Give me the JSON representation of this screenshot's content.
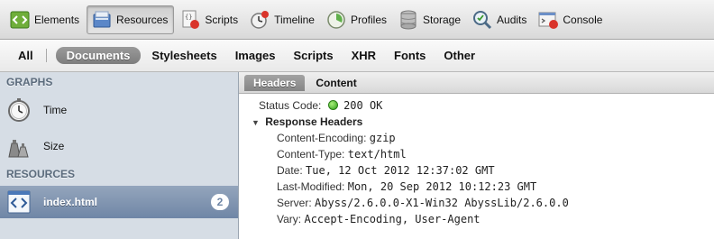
{
  "toolbar": {
    "items": [
      {
        "label": "Elements",
        "icon": "elements-icon",
        "selected": false
      },
      {
        "label": "Resources",
        "icon": "resources-icon",
        "selected": true
      },
      {
        "label": "Scripts",
        "icon": "scripts-icon",
        "selected": false
      },
      {
        "label": "Timeline",
        "icon": "timeline-icon",
        "selected": false
      },
      {
        "label": "Profiles",
        "icon": "profiles-icon",
        "selected": false
      },
      {
        "label": "Storage",
        "icon": "storage-icon",
        "selected": false
      },
      {
        "label": "Audits",
        "icon": "audits-icon",
        "selected": false
      },
      {
        "label": "Console",
        "icon": "console-icon",
        "selected": false
      }
    ]
  },
  "filters": {
    "all": "All",
    "documents": "Documents",
    "stylesheets": "Stylesheets",
    "images": "Images",
    "scripts": "Scripts",
    "xhr": "XHR",
    "fonts": "Fonts",
    "other": "Other",
    "selected": "Documents"
  },
  "sidebar": {
    "graphs_heading": "GRAPHS",
    "time_label": "Time",
    "size_label": "Size",
    "resources_heading": "RESOURCES",
    "resource": {
      "label": "index.html",
      "badge": "2"
    }
  },
  "tabs": {
    "headers": "Headers",
    "content": "Content",
    "selected": "Headers"
  },
  "headers": {
    "status_label": "Status Code:",
    "status_value": "200 OK",
    "status_color": "#3cb026",
    "response_headers_label": "Response Headers",
    "items": [
      {
        "key": "Content-Encoding:",
        "value": "gzip"
      },
      {
        "key": "Content-Type:",
        "value": "text/html"
      },
      {
        "key": "Date:",
        "value": "Tue, 12 Oct 2012 12:37:02 GMT"
      },
      {
        "key": "Last-Modified:",
        "value": "Mon, 20 Sep 2012 10:12:23 GMT"
      },
      {
        "key": "Server:",
        "value": "Abyss/2.6.0.0-X1-Win32 AbyssLib/2.6.0.0"
      },
      {
        "key": "Vary:",
        "value": "Accept-Encoding, User-Agent"
      }
    ]
  },
  "colors": {
    "sidebar_bg": "#d6dde5",
    "sidebar_selected": "#7b90ae",
    "accent_gray": "#8f8f8f"
  }
}
